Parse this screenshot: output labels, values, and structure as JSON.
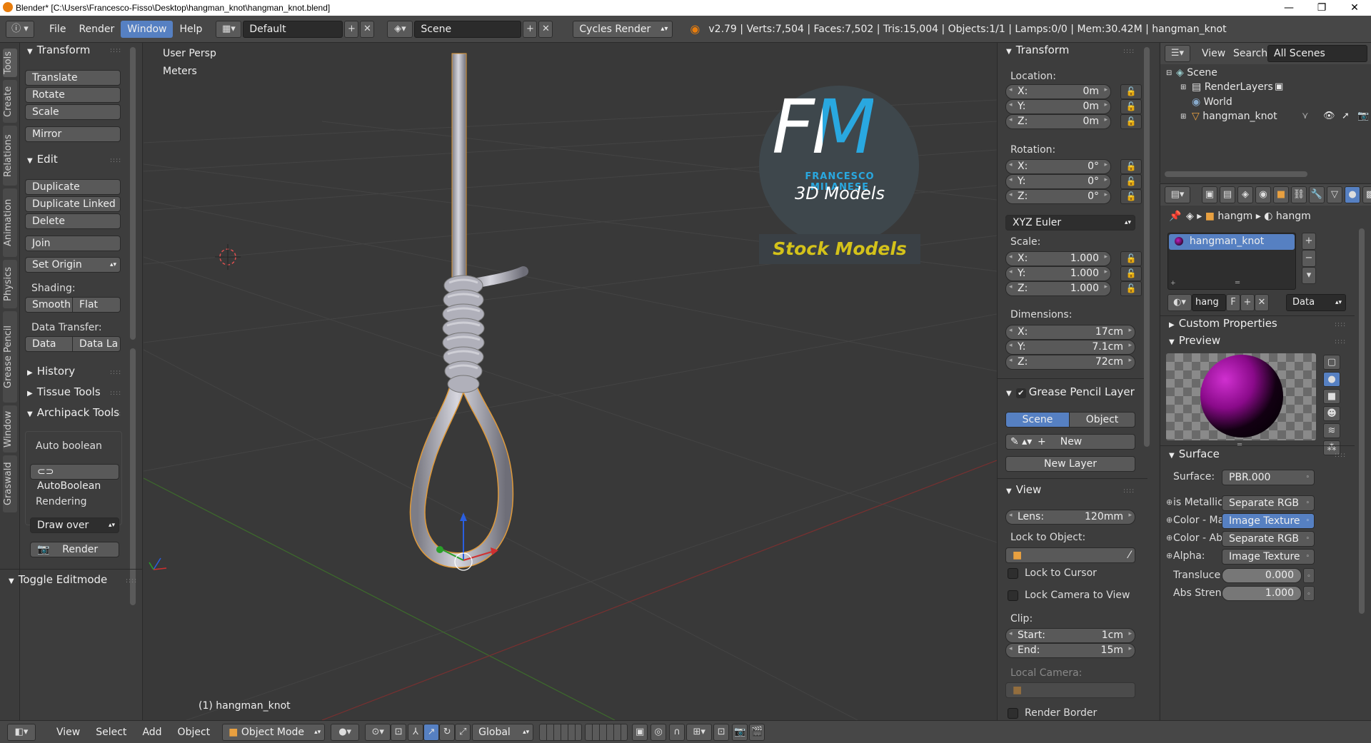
{
  "window": {
    "title": "Blender* [C:\\Users\\Francesco-Fisso\\Desktop\\hangman_knot\\hangman_knot.blend]",
    "minimize": "—",
    "maximize": "❐",
    "close": "✕"
  },
  "topbar": {
    "menus": [
      "File",
      "Render",
      "Window",
      "Help"
    ],
    "active_menu": "Window",
    "layout": "Default",
    "scene": "Scene",
    "engine": "Cycles Render",
    "stats": "v2.79 | Verts:7,504 | Faces:7,502 | Tris:15,004 | Objects:1/1 | Lamps:0/0 | Mem:30.42M | hangman_knot"
  },
  "tabs": [
    "Tools",
    "Create",
    "Relations",
    "Animation",
    "Physics",
    "Grease Pencil",
    "Window",
    "Graswald"
  ],
  "toolshelf": {
    "transform": {
      "title": "Transform",
      "buttons": [
        "Translate",
        "Rotate",
        "Scale",
        "Mirror"
      ]
    },
    "edit": {
      "title": "Edit",
      "buttons": [
        "Duplicate",
        "Duplicate Linked",
        "Delete",
        "Join"
      ],
      "set_origin": "Set Origin",
      "shading_label": "Shading:",
      "smooth": "Smooth",
      "flat": "Flat",
      "data_transfer_label": "Data Transfer:",
      "data": "Data",
      "data_la": "Data La"
    },
    "history": "History",
    "tissue": "Tissue Tools",
    "archipack": "Archipack Tools",
    "auto_boolean_label": "Auto boolean",
    "auto_boolean_btn": "AutoBoolean",
    "rendering_label": "Rendering",
    "draw_over": "Draw over",
    "render_btn": "Render",
    "toggle_editmode": "Toggle Editmode"
  },
  "viewport": {
    "view_name": "User Persp",
    "units": "Meters",
    "object_label": "(1) hangman_knot",
    "logo": {
      "letters": "FM",
      "name": "FRANCESCO MILANESE",
      "sub": "3D Models",
      "banner": "Stock Models"
    }
  },
  "bottombar": {
    "menus": [
      "View",
      "Select",
      "Add",
      "Object"
    ],
    "mode": "Object Mode",
    "orientation": "Global"
  },
  "npanel": {
    "transform_title": "Transform",
    "location_label": "Location:",
    "location": [
      {
        "k": "X:",
        "v": "0m"
      },
      {
        "k": "Y:",
        "v": "0m"
      },
      {
        "k": "Z:",
        "v": "0m"
      }
    ],
    "rotation_label": "Rotation:",
    "rotation": [
      {
        "k": "X:",
        "v": "0°"
      },
      {
        "k": "Y:",
        "v": "0°"
      },
      {
        "k": "Z:",
        "v": "0°"
      }
    ],
    "rotation_mode": "XYZ Euler",
    "scale_label": "Scale:",
    "scale": [
      {
        "k": "X:",
        "v": "1.000"
      },
      {
        "k": "Y:",
        "v": "1.000"
      },
      {
        "k": "Z:",
        "v": "1.000"
      }
    ],
    "dimensions_label": "Dimensions:",
    "dimensions": [
      {
        "k": "X:",
        "v": "17cm"
      },
      {
        "k": "Y:",
        "v": "7.1cm"
      },
      {
        "k": "Z:",
        "v": "72cm"
      }
    ],
    "gp_title": "Grease Pencil Layer",
    "gp_scene": "Scene",
    "gp_object": "Object",
    "gp_new": "New",
    "gp_new_layer": "New Layer",
    "view_title": "View",
    "lens_k": "Lens:",
    "lens_v": "120mm",
    "lock_to_object": "Lock to Object:",
    "lock_to_cursor": "Lock to Cursor",
    "lock_camera": "Lock Camera to View",
    "clip_label": "Clip:",
    "clip_start_k": "Start:",
    "clip_start_v": "1cm",
    "clip_end_k": "End:",
    "clip_end_v": "15m",
    "local_camera": "Local Camera:",
    "render_border": "Render Border"
  },
  "outliner": {
    "view": "View",
    "search": "Search",
    "filter": "All Scenes",
    "items": [
      "Scene",
      "RenderLayers",
      "World",
      "hangman_knot"
    ]
  },
  "props": {
    "crumb1": "hangm",
    "crumb2": "hangm",
    "material_slot": "hangman_knot",
    "mat_name": "hang",
    "mat_f": "F",
    "link": "Data",
    "custom_props": "Custom Properties",
    "preview": "Preview",
    "surface_title": "Surface",
    "surface_k": "Surface:",
    "surface_v": "PBR.000",
    "inputs": [
      {
        "k": "is Metallic",
        "v": "Separate RGB"
      },
      {
        "k": "Color - Ma",
        "v": "Image Texture"
      },
      {
        "k": "Color - Ab",
        "v": "Separate RGB"
      },
      {
        "k": "Alpha:",
        "v": "Image Texture"
      }
    ],
    "transluce_k": "Transluce",
    "transluce_v": "0.000",
    "abs_k": "Abs Stren",
    "abs_v": "1.000"
  },
  "colors": {
    "accent": "#5680c2",
    "logo_cyan": "#29a8e0",
    "logo_yellow": "#d4c21a",
    "rope": "#b8b8c0"
  }
}
